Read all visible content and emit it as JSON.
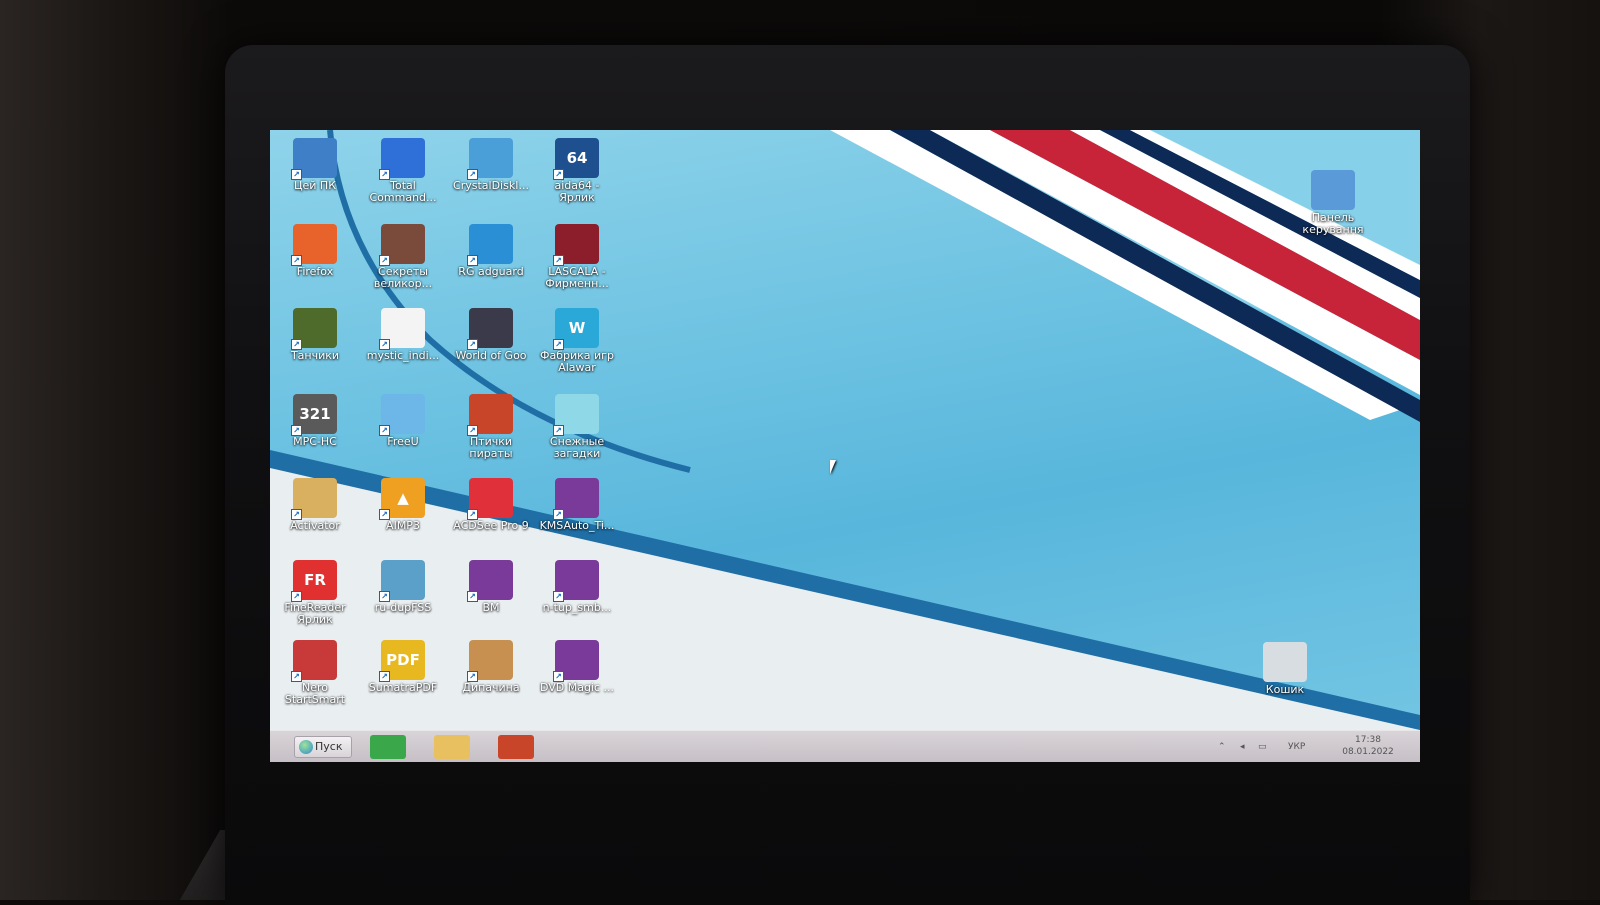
{
  "desktop": {
    "icons": [
      {
        "label": "Цей ПК",
        "icon": "computer-icon",
        "color": "#3f7fc8"
      },
      {
        "label": "Total\nCommand...",
        "icon": "floppy-disk-icon",
        "color": "#2f6fd8"
      },
      {
        "label": "CrystalDiskI...",
        "icon": "disk-info-icon",
        "color": "#4a9fd8"
      },
      {
        "label": "aida64 -\nЯрлик",
        "icon": "aida64-icon",
        "color": "#1e4f8f",
        "glyph": "64"
      },
      {
        "label": "Firefox",
        "icon": "firefox-icon",
        "color": "#e8632b"
      },
      {
        "label": "Секреты\nвеликор...",
        "icon": "game-portrait-icon",
        "color": "#7a4b3a"
      },
      {
        "label": "RG adguard",
        "icon": "globe-icon",
        "color": "#2b8fd6"
      },
      {
        "label": "LASCALA -\nФирменн...",
        "icon": "movie-poster-icon",
        "color": "#8b1e2a"
      },
      {
        "label": "Танчики",
        "icon": "tank-icon",
        "color": "#4f6b2c"
      },
      {
        "label": "mystic_indi...",
        "icon": "blank-file-icon",
        "color": "#f4f4f4"
      },
      {
        "label": "World of Goo",
        "icon": "goo-ball-icon",
        "color": "#3a3a4a"
      },
      {
        "label": "Фабрика игр\nAlawar",
        "icon": "alawar-icon",
        "color": "#2aa8d8",
        "glyph": "W"
      },
      {
        "label": "MPC-HC",
        "icon": "mpc-hc-icon",
        "color": "#5a5a5a",
        "glyph": "321"
      },
      {
        "label": "FreeU",
        "icon": "bird-icon",
        "color": "#6cb6e8"
      },
      {
        "label": "Птички\nпираты",
        "icon": "pirate-bird-icon",
        "color": "#c8452a"
      },
      {
        "label": "Снежные\nзагадки",
        "icon": "ice-cube-icon",
        "color": "#8fd8e8"
      },
      {
        "label": "Activator",
        "icon": "activator-icon",
        "color": "#d8b060"
      },
      {
        "label": "AIMP3",
        "icon": "aimp-icon",
        "color": "#f0a020",
        "glyph": "▲"
      },
      {
        "label": "ACDSee Pro 9",
        "icon": "camera-icon",
        "color": "#e0303a"
      },
      {
        "label": "KMSAuto_Ti...",
        "icon": "winrar-icon",
        "color": "#7a3a9a"
      },
      {
        "label": "FineReader\nЯрлик",
        "icon": "finereader-icon",
        "color": "#e03030",
        "glyph": "FR"
      },
      {
        "label": "ru-dupFSS",
        "icon": "setup-icon",
        "color": "#5aa0c8"
      },
      {
        "label": "BM",
        "icon": "winrar-icon",
        "color": "#7a3a9a"
      },
      {
        "label": "n-tup_smb...",
        "icon": "winrar-icon",
        "color": "#7a3a9a"
      },
      {
        "label": "Nero\nStartSmart",
        "icon": "nero-icon",
        "color": "#c83a3a"
      },
      {
        "label": "SumatraPDF",
        "icon": "pdf-icon",
        "color": "#e8b820",
        "glyph": "PDF"
      },
      {
        "label": "Дипачина",
        "icon": "game-character-icon",
        "color": "#c89050"
      },
      {
        "label": "DVD Magic ...",
        "icon": "winrar-icon",
        "color": "#7a3a9a"
      }
    ],
    "right_icons": [
      {
        "label": "Панель\nкерування",
        "icon": "control-panel-icon",
        "color": "#5a9ad8"
      },
      {
        "label": "Кошик",
        "icon": "recycle-bin-icon",
        "color": "#d8dde2"
      }
    ]
  },
  "taskbar": {
    "start_label": "Пуск",
    "apps": [
      {
        "name": "store",
        "icon": "store-icon",
        "color": "#3aa84a"
      },
      {
        "name": "explorer",
        "icon": "folder-icon",
        "color": "#e8c060"
      },
      {
        "name": "game",
        "icon": "pirate-bird-icon",
        "color": "#c8452a"
      }
    ],
    "tray": {
      "language": "УКР",
      "time": "17:38",
      "date": "08.01.2022"
    }
  }
}
